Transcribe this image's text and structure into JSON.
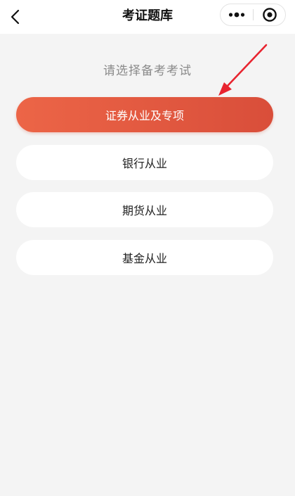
{
  "nav": {
    "title": "考证题库",
    "back_icon": "chevron-left-icon",
    "more_icon": "more-dots-icon",
    "close_icon": "target-circle-icon"
  },
  "prompt": "请选择备考考试",
  "options": [
    {
      "label": "证券从业及专项",
      "selected": true
    },
    {
      "label": "银行从业",
      "selected": false
    },
    {
      "label": "期货从业",
      "selected": false
    },
    {
      "label": "基金从业",
      "selected": false
    }
  ],
  "colors": {
    "accent_start": "#ec6547",
    "accent_end": "#d94e3a",
    "annotation": "#e8242f",
    "background": "#f4f4f4"
  }
}
